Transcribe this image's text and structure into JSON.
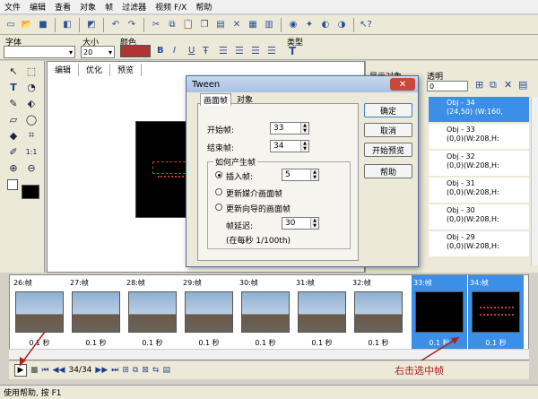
{
  "menu": [
    "文件",
    "编辑",
    "查看",
    "对象",
    "帧",
    "过滤器",
    "视频 F/X",
    "帮助"
  ],
  "fontbar": {
    "font_label": "字体",
    "size_label": "大小",
    "size_value": "20",
    "color_label": "颜色",
    "type_label": "类型",
    "bold": "B",
    "italic": "I",
    "underline": "U"
  },
  "stage_tabs": [
    "编辑",
    "优化",
    "预览"
  ],
  "dialog": {
    "title": "Tween",
    "tabs": [
      "画面帧",
      "对象"
    ],
    "start_label": "开始帧:",
    "start_value": "33",
    "end_label": "结束帧:",
    "end_value": "34",
    "group_label": "如何产生帧",
    "insert_label": "插入帧:",
    "insert_value": "5",
    "update_media": "更新媒介画面帧",
    "update_wizard": "更新向导的画面帧",
    "delay_label": "帧延迟:",
    "delay_value": "30",
    "delay_hint": "(在每秒 1/100th)",
    "ok": "确定",
    "cancel": "取消",
    "preview": "开始预览",
    "help": "帮助"
  },
  "objpanel": {
    "show_label": "显示对象",
    "trans_label": "透明",
    "trans_value": "0",
    "rows": [
      {
        "name": "Obj - 34",
        "info": "(24,50) (W:160,"
      },
      {
        "name": "Obj - 33",
        "info": "(0,0)(W:208,H:"
      },
      {
        "name": "Obj - 32",
        "info": "(0,0)(W:208,H:"
      },
      {
        "name": "Obj - 31",
        "info": "(0,0)(W:208,H:"
      },
      {
        "name": "Obj - 30",
        "info": "(0,0)(W:208,H:"
      },
      {
        "name": "Obj - 29",
        "info": "(0,0)(W:208,H:"
      }
    ]
  },
  "frames": [
    {
      "label": "26:帧",
      "dur": "0.1 秒"
    },
    {
      "label": "27:帧",
      "dur": "0.1 秒"
    },
    {
      "label": "28:帧",
      "dur": "0.1 秒"
    },
    {
      "label": "29:帧",
      "dur": "0.1 秒"
    },
    {
      "label": "30:帧",
      "dur": "0.1 秒"
    },
    {
      "label": "31:帧",
      "dur": "0.1 秒"
    },
    {
      "label": "32:帧",
      "dur": "0.1 秒"
    },
    {
      "label": "33:帧",
      "dur": "0.1 秒"
    },
    {
      "label": "34:帧",
      "dur": "0.1 秒"
    }
  ],
  "playbar": {
    "counter": "34/34"
  },
  "annotation": "右击选中帧",
  "status": "使用帮助, 按 F1",
  "colors": {
    "accent": "#3c8fe6",
    "text_color_swatch": "#b03434",
    "annotation": "#b02020"
  }
}
